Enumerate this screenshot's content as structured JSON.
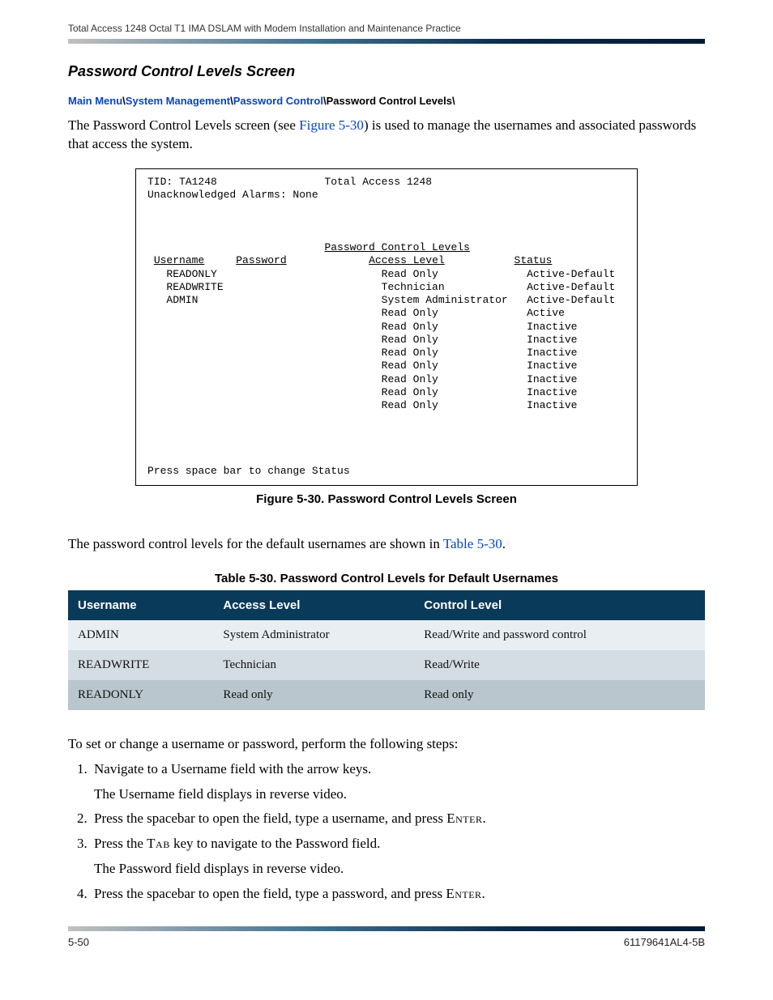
{
  "header": {
    "running_head": "Total Access 1248 Octal T1 IMA DSLAM with Modem Installation and Maintenance Practice"
  },
  "section_title": "Password Control Levels Screen",
  "breadcrumb": {
    "items": [
      {
        "text": "Main Menu",
        "link": true
      },
      {
        "text": "\\",
        "sep": true
      },
      {
        "text": "System Management",
        "link": true
      },
      {
        "text": "\\",
        "sep": true
      },
      {
        "text": "Password Control",
        "link": true
      },
      {
        "text": "\\",
        "sep": true
      },
      {
        "text": "Password Control Levels",
        "link": false
      },
      {
        "text": "\\",
        "sep": true
      }
    ]
  },
  "intro": {
    "pre": "The Password Control Levels screen (see ",
    "xref": "Figure 5-30",
    "post": ") is used to manage the usernames and associated passwords that access the system."
  },
  "terminal": {
    "tid_label": "TID:",
    "tid_value": "TA1248",
    "product": "Total Access 1248",
    "alarms_label": "Unacknowledged Alarms:",
    "alarms_value": "None",
    "screen_title": "Password Control Levels",
    "columns": {
      "username": "Username",
      "password": "Password",
      "access": "Access Level",
      "status": "Status"
    },
    "rows": [
      {
        "username": "READONLY",
        "password": "",
        "access": "Read Only",
        "status": "Active-Default"
      },
      {
        "username": "READWRITE",
        "password": "",
        "access": "Technician",
        "status": "Active-Default"
      },
      {
        "username": "ADMIN",
        "password": "",
        "access": "System Administrator",
        "status": "Active-Default"
      },
      {
        "username": "",
        "password": "",
        "access": "Read Only",
        "status": "Active"
      },
      {
        "username": "",
        "password": "",
        "access": "Read Only",
        "status": "Inactive"
      },
      {
        "username": "",
        "password": "",
        "access": "Read Only",
        "status": "Inactive"
      },
      {
        "username": "",
        "password": "",
        "access": "Read Only",
        "status": "Inactive"
      },
      {
        "username": "",
        "password": "",
        "access": "Read Only",
        "status": "Inactive"
      },
      {
        "username": "",
        "password": "",
        "access": "Read Only",
        "status": "Inactive"
      },
      {
        "username": "",
        "password": "",
        "access": "Read Only",
        "status": "Inactive"
      },
      {
        "username": "",
        "password": "",
        "access": "Read Only",
        "status": "Inactive"
      }
    ],
    "footer_hint": "Press space bar to change Status"
  },
  "figure_caption": "Figure 5-30.  Password Control Levels Screen",
  "mid_para": {
    "pre": "The password control levels for the default usernames are shown in ",
    "xref": "Table 5-30",
    "post": "."
  },
  "table_title": "Table 5-30.  Password Control Levels for Default Usernames",
  "table": {
    "headers": {
      "username": "Username",
      "access": "Access Level",
      "control": "Control Level"
    },
    "rows": [
      {
        "username": "ADMIN",
        "access": "System Administrator",
        "control": "Read/Write and password control"
      },
      {
        "username": "READWRITE",
        "access": "Technician",
        "control": "Read/Write"
      },
      {
        "username": "READONLY",
        "access": "Read only",
        "control": "Read only"
      }
    ]
  },
  "steps_intro": "To set or change a username or password, perform the following steps:",
  "steps": [
    {
      "main": "Navigate to a Username field with the arrow keys.",
      "sub": "The Username field displays in reverse video."
    },
    {
      "seg": [
        {
          "t": "Press the spacebar to open the field, type a username, and press "
        },
        {
          "t": "Enter",
          "sc": true
        },
        {
          "t": "."
        }
      ]
    },
    {
      "seg": [
        {
          "t": "Press the "
        },
        {
          "t": "Tab",
          "sc": true
        },
        {
          "t": " key to navigate to the Password field."
        }
      ],
      "sub": "The Password field displays in reverse video."
    },
    {
      "seg": [
        {
          "t": "Press the spacebar to open the field, type a password, and press "
        },
        {
          "t": "Enter",
          "sc": true
        },
        {
          "t": "."
        }
      ]
    }
  ],
  "footer": {
    "page": "5-50",
    "doc": "61179641AL4-5B"
  }
}
